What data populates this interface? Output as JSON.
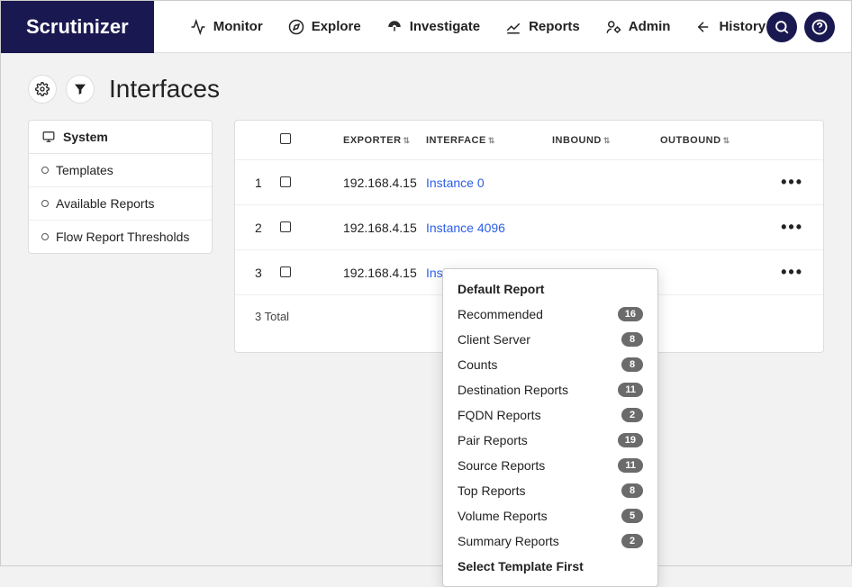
{
  "brand": "Scrutinizer",
  "nav": {
    "monitor": "Monitor",
    "explore": "Explore",
    "investigate": "Investigate",
    "reports": "Reports",
    "admin": "Admin",
    "history": "History"
  },
  "page": {
    "title": "Interfaces"
  },
  "sidebar": {
    "header": "System",
    "items": [
      {
        "label": "Templates"
      },
      {
        "label": "Available Reports"
      },
      {
        "label": "Flow Report Thresholds"
      }
    ]
  },
  "table": {
    "cols": {
      "exporter": "EXPORTER",
      "interface": "INTERFACE",
      "inbound": "INBOUND",
      "outbound": "OUTBOUND"
    },
    "rows": [
      {
        "n": "1",
        "exporter": "192.168.4.15",
        "interface": "Instance 0"
      },
      {
        "n": "2",
        "exporter": "192.168.4.15",
        "interface": "Instance 4096"
      },
      {
        "n": "3",
        "exporter": "192.168.4.15",
        "interface": "Instance 4097"
      }
    ],
    "footer": "3 Total"
  },
  "popup": {
    "default": "Default Report",
    "items": [
      {
        "label": "Recommended",
        "count": "16"
      },
      {
        "label": "Client Server",
        "count": "8"
      },
      {
        "label": "Counts",
        "count": "8"
      },
      {
        "label": "Destination Reports",
        "count": "11"
      },
      {
        "label": "FQDN Reports",
        "count": "2"
      },
      {
        "label": "Pair Reports",
        "count": "19"
      },
      {
        "label": "Source Reports",
        "count": "11"
      },
      {
        "label": "Top Reports",
        "count": "8"
      },
      {
        "label": "Volume Reports",
        "count": "5"
      },
      {
        "label": "Summary Reports",
        "count": "2"
      }
    ],
    "select": "Select Template First"
  }
}
